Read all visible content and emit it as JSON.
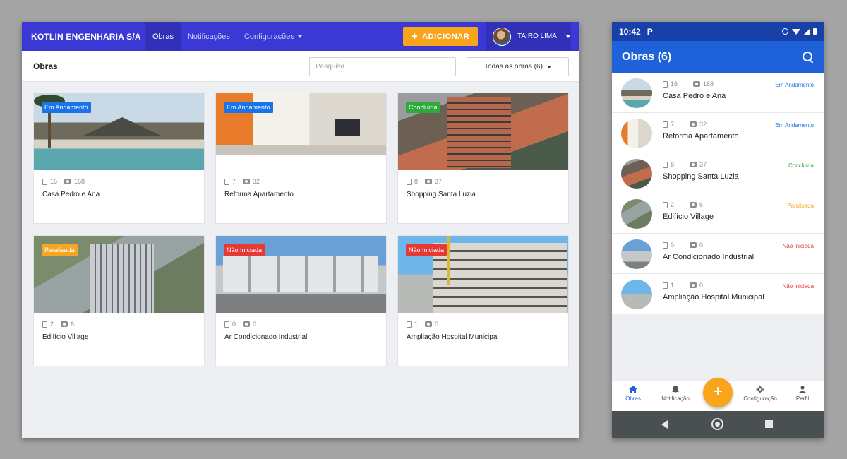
{
  "desktop": {
    "brand": "KOTLIN ENGENHARIA S/A",
    "nav": [
      {
        "label": "Obras",
        "active": true
      },
      {
        "label": "Notificações",
        "active": false
      },
      {
        "label": "Configurações",
        "active": false
      }
    ],
    "add_label": "ADICIONAR",
    "add_icon": "plus-icon",
    "user_name": "TAIRO LIMA",
    "page_title": "Obras",
    "search_placeholder": "Pesquisa",
    "filter_label": "Todas as obras (6)",
    "cards": [
      {
        "name": "Casa Pedro e Ana",
        "status": "Em Andamento",
        "docs": "16",
        "photos": "168"
      },
      {
        "name": "Reforma Apartamento",
        "status": "Em Andamento",
        "docs": "7",
        "photos": "32"
      },
      {
        "name": "Shopping Santa Luzia",
        "status": "Concluída",
        "docs": "8",
        "photos": "37"
      },
      {
        "name": "Edifício Village",
        "status": "Paralisada",
        "docs": "2",
        "photos": "6"
      },
      {
        "name": "Ar Condicionado Industrial",
        "status": "Não Iniciada",
        "docs": "0",
        "photos": "0"
      },
      {
        "name": "Ampliação Hospital Municipal",
        "status": "Não Iniciada",
        "docs": "1",
        "photos": "0"
      }
    ]
  },
  "status_colors": {
    "Em Andamento": "#1a73e8",
    "Concluída": "#2eaa3c",
    "Paralisada": "#f5a623",
    "Não Iniciada": "#e53935"
  },
  "mobile": {
    "time": "10:42",
    "notif_glyph": "P",
    "title": "Obras (6)",
    "items": [
      {
        "name": "Casa Pedro e Ana",
        "status": "Em Andamento",
        "docs": "16",
        "photos": "168"
      },
      {
        "name": "Reforma Apartamento",
        "status": "Em Andamento",
        "docs": "7",
        "photos": "32"
      },
      {
        "name": "Shopping Santa Luzia",
        "status": "Concluída",
        "docs": "8",
        "photos": "37"
      },
      {
        "name": "Edifício Village",
        "status": "Paralisada",
        "docs": "2",
        "photos": "6"
      },
      {
        "name": "Ar Condicionado Industrial",
        "status": "Não Iniciada",
        "docs": "0",
        "photos": "0"
      },
      {
        "name": "Ampliação Hospital Municipal",
        "status": "Não Iniciada",
        "docs": "1",
        "photos": "0"
      }
    ],
    "bottom_nav": [
      {
        "label": "Obras",
        "icon": "home-icon",
        "active": true
      },
      {
        "label": "Notificação",
        "icon": "bell-icon",
        "active": false
      },
      {
        "label": "Configuração",
        "icon": "gear-icon",
        "active": false
      },
      {
        "label": "Perfil",
        "icon": "person-icon",
        "active": false
      }
    ],
    "fab_icon": "plus-icon"
  }
}
